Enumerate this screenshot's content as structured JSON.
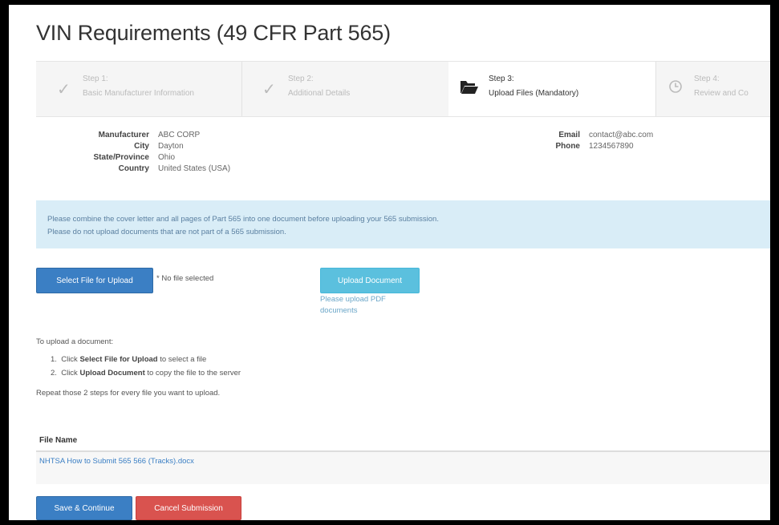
{
  "page": {
    "title": "VIN Requirements (49 CFR Part 565)"
  },
  "steps": [
    {
      "line1": "Step 1:",
      "line2": "Basic Manufacturer Information",
      "icon": "check-icon",
      "state": "done"
    },
    {
      "line1": "Step 2:",
      "line2": "Additional Details",
      "icon": "check-icon",
      "state": "done"
    },
    {
      "line1": "Step 3:",
      "line2": "Upload Files (Mandatory)",
      "icon": "folder-open-icon",
      "state": "active"
    },
    {
      "line1": "Step 4:",
      "line2": "Review and Co",
      "icon": "clock-icon",
      "state": "pending"
    }
  ],
  "manufacturer": {
    "manufacturer_label": "Manufacturer",
    "manufacturer_value": "ABC CORP",
    "city_label": "City",
    "city_value": "Dayton",
    "state_label": "State/Province",
    "state_value": "Ohio",
    "country_label": "Country",
    "country_value": "United States (USA)",
    "email_label": "Email",
    "email_value": "contact@abc.com",
    "phone_label": "Phone",
    "phone_value": "1234567890"
  },
  "alert": {
    "line1": "Please combine the cover letter and all pages of Part 565 into one document before uploading your 565 submission.",
    "line2": "Please do not upload documents that are not part of a 565 submission."
  },
  "upload": {
    "select_label": "Select File for Upload",
    "no_file": "* No file selected",
    "upload_label": "Upload Document",
    "hint_line1": "Please upload PDF",
    "hint_line2": "documents"
  },
  "instructions": {
    "intro": "To upload a document:",
    "step1_num": "1.",
    "step1_pre": "Click",
    "step1_bold": "Select File for Upload",
    "step1_post": "to select a file",
    "step2_num": "2.",
    "step2_pre": "Click",
    "step2_bold": "Upload Document",
    "step2_post": "to copy the file to the server",
    "repeat": "Repeat those 2 steps for every file you want to upload."
  },
  "files": {
    "header": "File Name",
    "rows": [
      {
        "name": "NHTSA How to Submit 565 566 (Tracks).docx"
      }
    ]
  },
  "actions": {
    "save_label": "Save & Continue",
    "cancel_label": "Cancel Submission"
  },
  "colors": {
    "primary": "#3b7fc4",
    "info": "#5bc0de",
    "danger": "#d9534f",
    "alert_bg": "#d9edf7"
  }
}
